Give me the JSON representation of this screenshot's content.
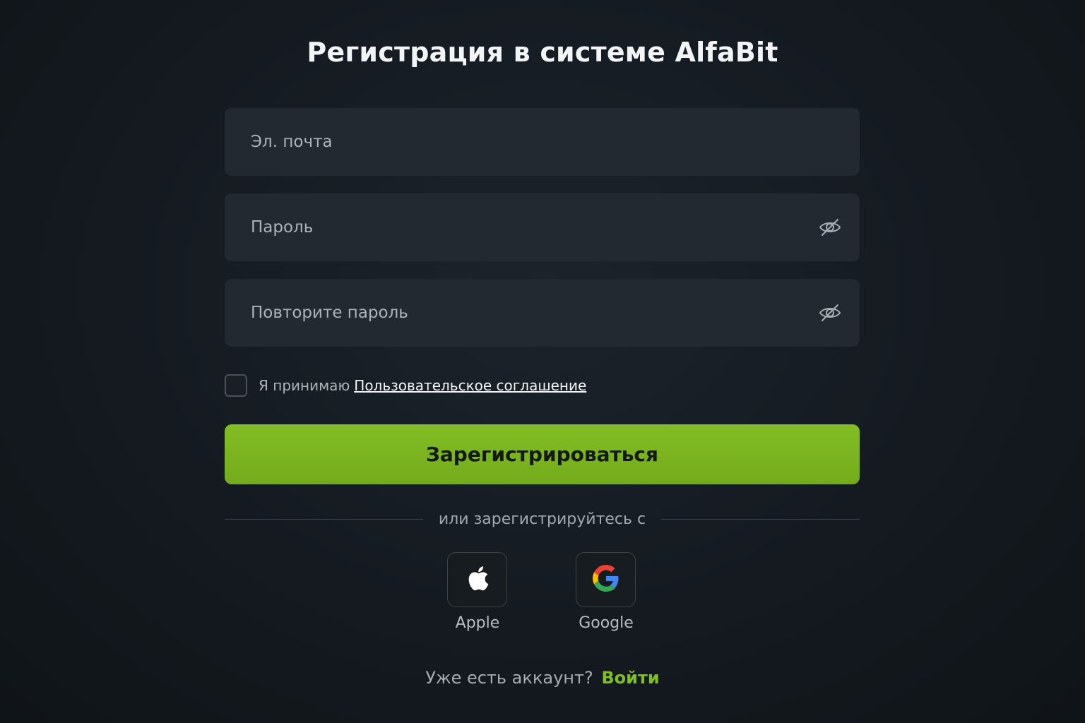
{
  "page": {
    "title": "Регистрация в системе AlfaBit"
  },
  "form": {
    "email_placeholder": "Эл. почта",
    "password_placeholder": "Пароль",
    "password_confirm_placeholder": "Повторите пароль",
    "email_value": "",
    "password_value": "",
    "password_confirm_value": "",
    "password_toggle_icon": "eye-off-icon",
    "agree_checked": false,
    "agree_text": "Я принимаю",
    "agree_link": "Пользовательское соглашение",
    "submit_label": "Зарегистрироваться"
  },
  "social": {
    "divider_text": "или зарегистрируйтесь с",
    "providers": [
      {
        "label": "Apple",
        "icon": "apple-icon"
      },
      {
        "label": "Google",
        "icon": "google-icon"
      }
    ]
  },
  "footer": {
    "have_account_text": "Уже есть аккаунт?",
    "login_link": "Войти"
  },
  "colors": {
    "accent": "#7fbf24",
    "background": "#141a20",
    "field_background": "#232930"
  }
}
